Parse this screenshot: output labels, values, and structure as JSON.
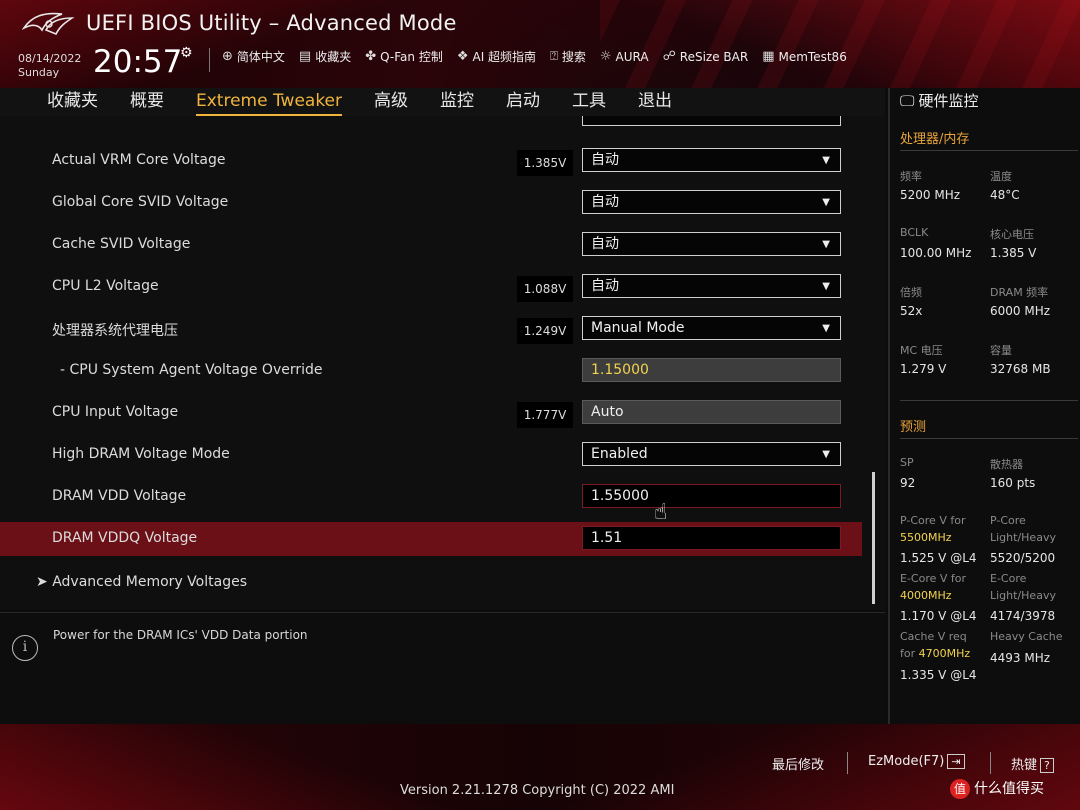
{
  "header": {
    "title": "UEFI BIOS Utility – Advanced Mode",
    "date": "08/14/2022",
    "day": "Sunday",
    "time": "20:57",
    "toolbar": [
      {
        "icon": "globe-icon",
        "label": "简体中文"
      },
      {
        "icon": "favorites-icon",
        "label": "收藏夹"
      },
      {
        "icon": "fan-icon",
        "label": "Q-Fan 控制"
      },
      {
        "icon": "ai-icon",
        "label": "AI 超频指南"
      },
      {
        "icon": "search-icon",
        "label": "搜索"
      },
      {
        "icon": "aura-icon",
        "label": "AURA"
      },
      {
        "icon": "resize-bar-icon",
        "label": "ReSize BAR"
      },
      {
        "icon": "memtest-icon",
        "label": "MemTest86"
      }
    ]
  },
  "menu": [
    {
      "label": "收藏夹"
    },
    {
      "label": "概要"
    },
    {
      "label": "Extreme Tweaker",
      "active": true
    },
    {
      "label": "高级"
    },
    {
      "label": "监控"
    },
    {
      "label": "启动"
    },
    {
      "label": "工具"
    },
    {
      "label": "退出"
    }
  ],
  "settings": [
    {
      "label": "Actual VRM Core Voltage",
      "readout": "1.385V",
      "value": "自动",
      "kind": "dropdown"
    },
    {
      "label": "Global Core SVID Voltage",
      "readout": "",
      "value": "自动",
      "kind": "dropdown"
    },
    {
      "label": "Cache SVID Voltage",
      "readout": "",
      "value": "自动",
      "kind": "dropdown"
    },
    {
      "label": "CPU L2 Voltage",
      "readout": "1.088V",
      "value": "自动",
      "kind": "dropdown"
    },
    {
      "label": "处理器系统代理电压",
      "readout": "1.249V",
      "value": "Manual Mode",
      "kind": "dropdown"
    },
    {
      "label": "- CPU System Agent Voltage Override",
      "readout": "",
      "value": "1.15000",
      "kind": "readonly-yellow"
    },
    {
      "label": "CPU Input Voltage",
      "readout": "1.777V",
      "value": "Auto",
      "kind": "readonly"
    },
    {
      "label": "High DRAM Voltage Mode",
      "readout": "",
      "value": "Enabled",
      "kind": "dropdown"
    },
    {
      "label": "DRAM VDD Voltage",
      "readout": "",
      "value": "1.55000",
      "kind": "text"
    },
    {
      "label": "DRAM VDDQ Voltage",
      "readout": "",
      "value": "1.51",
      "kind": "text",
      "selected": true
    },
    {
      "label": "Advanced Memory Voltages",
      "readout": "",
      "value": "",
      "kind": "submenu"
    }
  ],
  "help": {
    "text": "Power for the DRAM ICs' VDD Data portion"
  },
  "monitor": {
    "title": "硬件监控",
    "section1": "处理器/内存",
    "items": [
      {
        "label": "频率",
        "value": "5200 MHz"
      },
      {
        "label": "温度",
        "value": "48°C"
      },
      {
        "label": "BCLK",
        "value": "100.00 MHz"
      },
      {
        "label": "核心电压",
        "value": "1.385 V"
      },
      {
        "label": "倍频",
        "value": "52x"
      },
      {
        "label": "DRAM 频率",
        "value": "6000 MHz"
      },
      {
        "label": "MC 电压",
        "value": "1.279 V"
      },
      {
        "label": "容量",
        "value": "32768 MB"
      }
    ],
    "section2": "预测",
    "prediction": {
      "sp_label": "SP",
      "sp_value": "92",
      "cooler_label": "散热器",
      "cooler_value": "160 pts",
      "pcore_label": "P-Core V for",
      "pcore_freq": "5500MHz",
      "pcore_value": "1.525 V @L4",
      "pcore_lh_label1": "P-Core",
      "pcore_lh_label2": "Light/Heavy",
      "pcore_lh_value": "5520/5200",
      "ecore_label": "E-Core V for",
      "ecore_freq": "4000MHz",
      "ecore_value": "1.170 V @L4",
      "ecore_lh_label1": "E-Core",
      "ecore_lh_label2": "Light/Heavy",
      "ecore_lh_value": "4174/3978",
      "cache_label1": "Cache V req",
      "cache_label2_prefix": "for",
      "cache_freq": "4700MHz",
      "cache_value": "1.335 V @L4",
      "heavy_cache_label": "Heavy Cache",
      "heavy_cache_value": "4493 MHz"
    }
  },
  "footer": {
    "last_modified": "最后修改",
    "ezmode": "EzMode(F7)",
    "ezmode_icon": "exit-arrow-icon",
    "hotkeys": "热键",
    "hotkey_key": "?",
    "version": "Version 2.21.1278 Copyright (C) 2022 AMI",
    "watermark": "什么值得买",
    "watermark_icon": "值"
  },
  "colors": {
    "accent": "#f0b43c",
    "selected_row": "#6a1016",
    "highlight_value": "#f2d24e",
    "section": "#e8a43a"
  }
}
